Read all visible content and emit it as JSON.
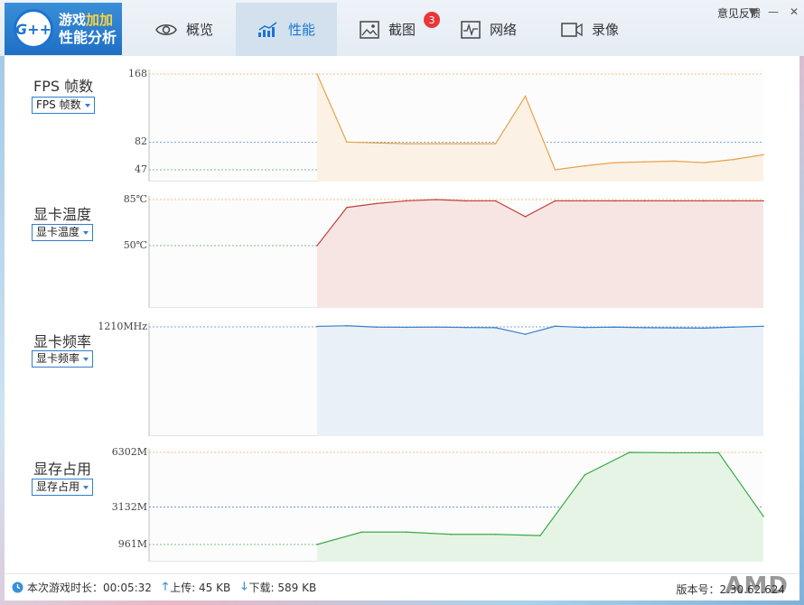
{
  "header": {
    "logo": {
      "mark": "G++",
      "line1_a": "游戏",
      "line1_b": "加加",
      "line2": "性能分析"
    },
    "tabs": [
      {
        "label": "概览",
        "icon": "eye-icon"
      },
      {
        "label": "性能",
        "icon": "performance-chart-icon"
      },
      {
        "label": "截图",
        "icon": "image-icon",
        "badge": "3"
      },
      {
        "label": "网络",
        "icon": "pulse-icon"
      },
      {
        "label": "录像",
        "icon": "video-camera-icon"
      }
    ],
    "active_tab": "性能",
    "feedback_label": "意见反馈"
  },
  "sections": [
    {
      "title": "FPS 帧数",
      "selector": "FPS 帧数"
    },
    {
      "title": "显卡温度",
      "selector": "显卡温度"
    },
    {
      "title": "显卡频率",
      "selector": "显卡频率"
    },
    {
      "title": "显存占用",
      "selector": "显存占用"
    }
  ],
  "statusbar": {
    "playtime_label": "本次游戏时长：",
    "playtime": "00:05:32",
    "upload_label": "上传:",
    "upload": "45 KB",
    "download_label": "下载:",
    "download": "589 KB",
    "version_label": "版本号：",
    "version": "2.30.62.624",
    "brand": "AMD"
  },
  "colors": {
    "accent": "#1c74cf",
    "fps_line": "#e7a24c",
    "temp_line": "#c0443a",
    "freq_line": "#3a7fc8",
    "vram_line": "#3aaa44"
  },
  "chart_data": [
    {
      "type": "area",
      "title": "FPS 帧数",
      "ticks": [
        "168",
        "82",
        "47"
      ],
      "tick_values": [
        168,
        82,
        47
      ],
      "ylim": [
        0,
        168
      ],
      "series": [
        {
          "values": [
            168,
            82,
            81,
            80,
            80,
            80,
            80,
            140,
            47,
            52,
            56,
            57,
            58,
            56,
            60,
            66
          ]
        }
      ]
    },
    {
      "type": "area",
      "title": "显卡温度",
      "ticks": [
        "85℃",
        "50℃"
      ],
      "tick_values": [
        85,
        50
      ],
      "ylim": [
        0,
        85
      ],
      "series": [
        {
          "values": [
            50,
            79,
            82,
            84,
            85,
            84,
            84,
            72,
            84,
            84,
            84,
            84,
            84,
            84,
            84,
            84
          ]
        }
      ]
    },
    {
      "type": "area",
      "title": "显卡频率",
      "ticks": [
        "1210MHz"
      ],
      "tick_values": [
        1210
      ],
      "ylim": [
        0,
        1210
      ],
      "series": [
        {
          "values": [
            1222,
            1237,
            1205,
            1200,
            1205,
            1195,
            1190,
            1028,
            1227,
            1195,
            1205,
            1190,
            1185,
            1180,
            1205,
            1225
          ]
        }
      ]
    },
    {
      "type": "area",
      "title": "显存占用",
      "ticks": [
        "6302M",
        "3132M",
        "961M"
      ],
      "tick_values": [
        6302,
        3132,
        961
      ],
      "ylim": [
        0,
        6302
      ],
      "series": [
        {
          "values": [
            961,
            1680,
            1680,
            1550,
            1550,
            1480,
            5000,
            6302,
            6280,
            6280,
            2600
          ]
        }
      ]
    }
  ]
}
